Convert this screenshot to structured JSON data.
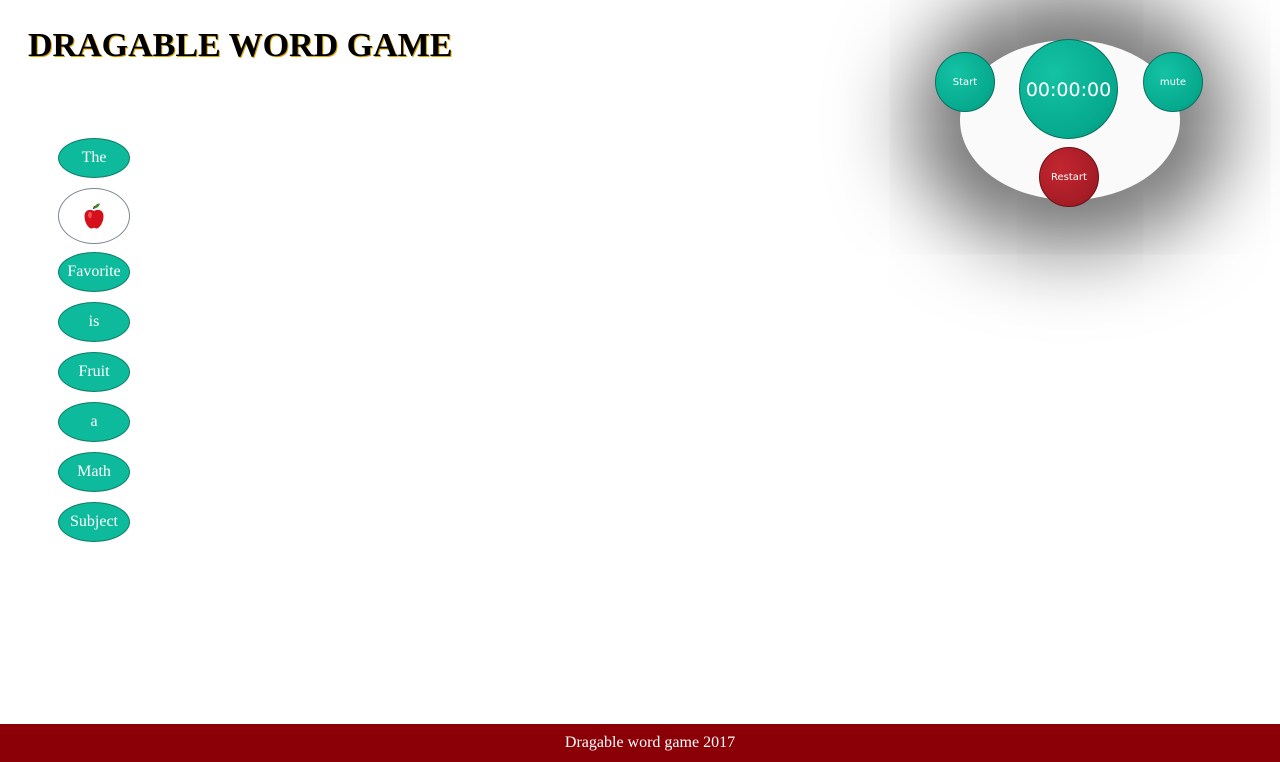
{
  "header": {
    "title": "DRAGABLE WORD GAME"
  },
  "controls": {
    "start_label": "Start",
    "timer_value": "00:00:00",
    "mute_label": "mute",
    "restart_label": "Restart"
  },
  "words": [
    {
      "label": "The",
      "kind": "text"
    },
    {
      "label": "",
      "kind": "image",
      "icon": "apple-icon"
    },
    {
      "label": "Favorite",
      "kind": "text"
    },
    {
      "label": "is",
      "kind": "text"
    },
    {
      "label": "Fruit",
      "kind": "text"
    },
    {
      "label": "a",
      "kind": "text"
    },
    {
      "label": "Math",
      "kind": "text"
    },
    {
      "label": "Subject",
      "kind": "text"
    }
  ],
  "footer": {
    "text": "Dragable word game 2017"
  },
  "colors": {
    "accent_teal": "#0dba9c",
    "restart_red": "#a51c25",
    "footer_bg": "#8b0007"
  }
}
